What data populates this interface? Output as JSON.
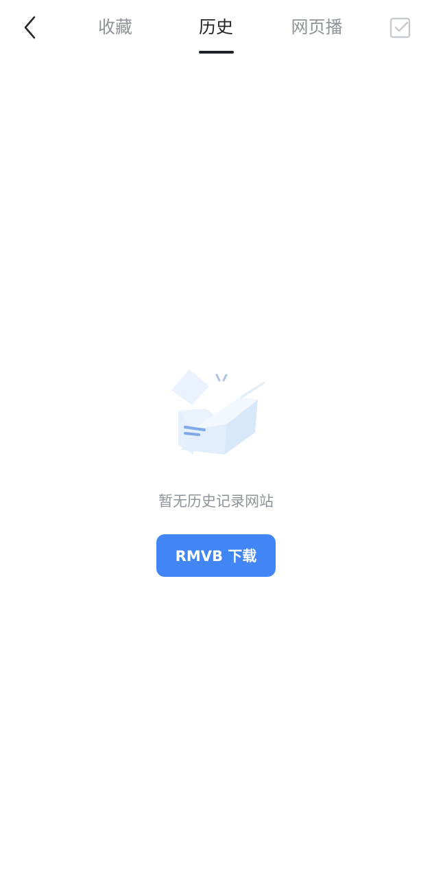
{
  "header": {
    "back_icon": "chevron-left-icon",
    "tabs": [
      {
        "label": "收藏",
        "active": false
      },
      {
        "label": "历史",
        "active": true
      },
      {
        "label": "网页播",
        "active": false
      }
    ],
    "select_icon": "checkbox-check-icon"
  },
  "empty_state": {
    "illustration_icon": "open-box-icon",
    "message": "暂无历史记录网站",
    "button_label": "RMVB 下载"
  },
  "colors": {
    "active_tab": "#1f2227",
    "inactive_tab": "#8d9399",
    "accent": "#4285f5",
    "button_text": "#ffffff"
  }
}
